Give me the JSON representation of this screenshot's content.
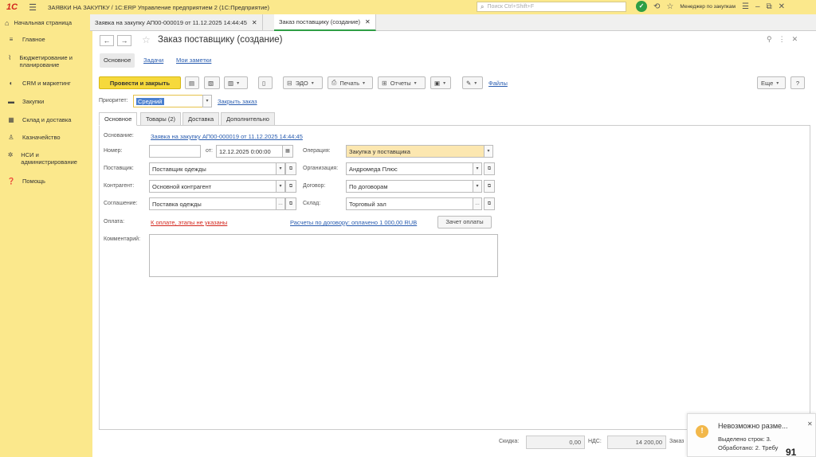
{
  "titlebar": {
    "logo": "1С",
    "title": "ЗАЯВКИ НА ЗАКУПКУ / 1С:ERP Управление предприятием 2  (1С:Предприятие)",
    "search_placeholder": "Поиск Ctrl+Shift+F",
    "user": "Менеджер по закупкам"
  },
  "tabs": {
    "home": "Начальная страница",
    "doc1": "Заявка на закупку АП00-000019 от 11.12.2025 14:44:45",
    "doc2": "Заказ поставщику (создание)"
  },
  "sidebar": {
    "items": [
      {
        "label": "Главное"
      },
      {
        "label": "Бюджетирование и планирование"
      },
      {
        "label": "CRM и маркетинг"
      },
      {
        "label": "Закупки"
      },
      {
        "label": "Склад и доставка"
      },
      {
        "label": "Казначейство"
      },
      {
        "label": "НСИ и администрирование"
      },
      {
        "label": "Помощь"
      }
    ]
  },
  "header": {
    "title": "Заказ поставщику (создание)",
    "subtabs": [
      "Основное",
      "Задачи",
      "Мои заметки"
    ]
  },
  "toolbar": {
    "post_close": "Провести и закрыть",
    "edo": "ЭДО",
    "print": "Печать",
    "reports": "Отчеты",
    "files": "Файлы",
    "more": "Еще"
  },
  "priority": {
    "label": "Приоритет:",
    "value": "Средний",
    "close_order": "Закрыть заказ"
  },
  "form_tabs": [
    "Основное",
    "Товары (2)",
    "Доставка",
    "Дополнительно"
  ],
  "form": {
    "basis_label": "Основание:",
    "basis_value": "Заявка на закупку АП00-000019 от 11.12.2025 14:44:45",
    "number_label": "Номер:",
    "number_value": "",
    "from_label": "от:",
    "date_value": "12.12.2025  0:00:00",
    "operation_label": "Операция:",
    "operation_value": "Закупка у поставщика",
    "supplier_label": "Поставщик:",
    "supplier_value": "Поставщик одежды",
    "org_label": "Организация:",
    "org_value": "Андромеда Плюс",
    "counterparty_label": "Контрагент:",
    "counterparty_value": "Основной контрагент",
    "contract_label": "Договор:",
    "contract_value": "По договорам",
    "agreement_label": "Соглашение:",
    "agreement_value": "Поставка одежды",
    "warehouse_label": "Склад:",
    "warehouse_value": "Торговый зал",
    "payment_label": "Оплата:",
    "payment_value": "К оплате, этапы не указаны",
    "settlements": "Расчеты по договору: оплачено 1 000,00 RUB",
    "offset_btn": "Зачет оплаты",
    "comment_label": "Комментарий:"
  },
  "footer": {
    "discount_label": "Скидка:",
    "discount_value": "0,00",
    "vat_label": "НДС:",
    "vat_value": "14 200,00",
    "order_label": "Заказ"
  },
  "notification": {
    "title": "Невозможно разме...",
    "line1": "Выделено строк: 3.",
    "line2": "Обработано: 2. Требу"
  },
  "page_number": "91"
}
